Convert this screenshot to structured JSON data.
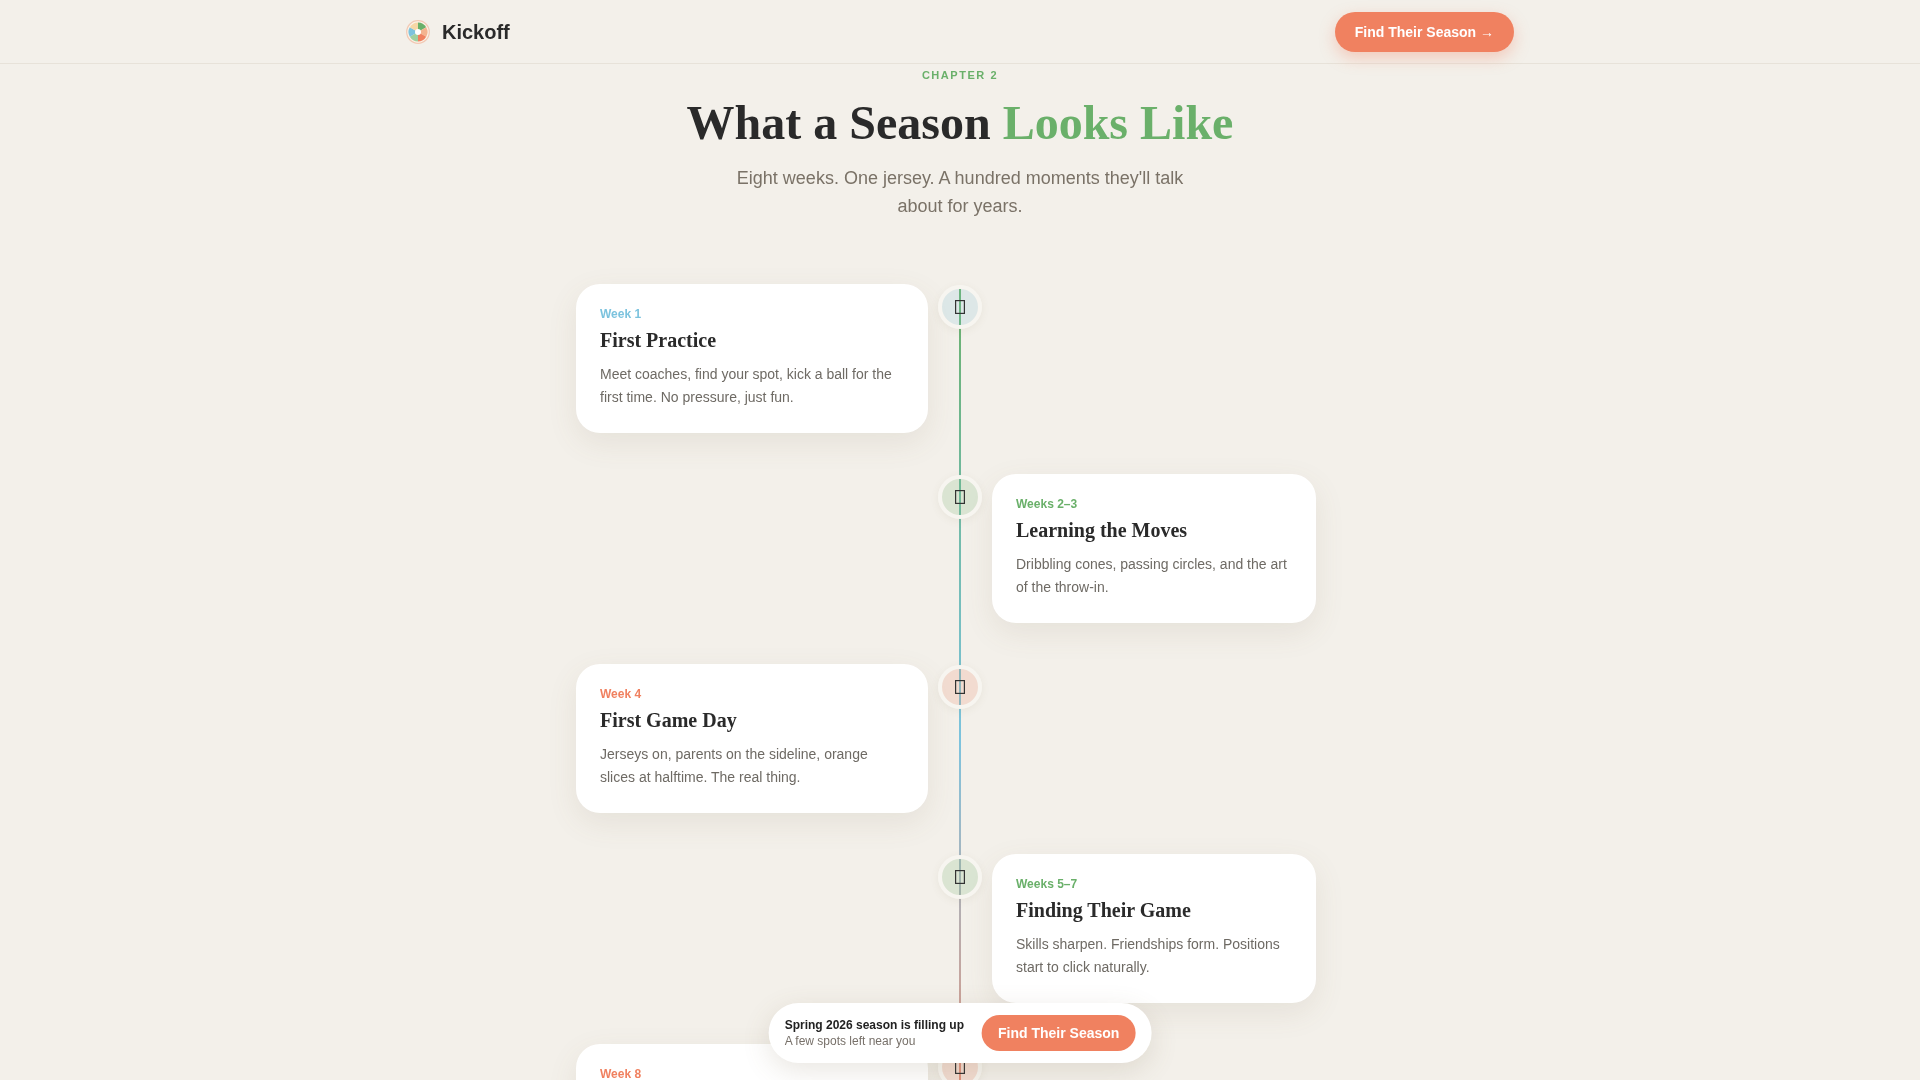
{
  "header": {
    "brand": "Kickoff",
    "cta": "Find Their Season →"
  },
  "intro": {
    "eyebrow": "CHAPTER 2",
    "title": "What a Season",
    "title_highlight": "Looks Like",
    "subtitle": "Eight weeks. One jersey. A hundred moments they'll talk about for years."
  },
  "timeline": [
    {
      "label": "Week 1",
      "color": "#7cc3de",
      "title": "First Practice",
      "text": "Meet coaches, find your spot, kick a ball for the first time. No pressure, just fun."
    },
    {
      "label": "Weeks 2–3",
      "color": "#6ab06a",
      "title": "Learning the Moves",
      "text": "Dribbling cones, passing circles, and the art of the throw-in."
    },
    {
      "label": "Week 4",
      "color": "#f08160",
      "title": "First Game Day",
      "text": "Jerseys on, parents on the sideline, orange slices at halftime. The real thing."
    },
    {
      "label": "Weeks 5–7",
      "color": "#6ab06a",
      "title": "Finding Their Game",
      "text": "Skills sharpen. Friendships form. Positions start to click naturally."
    },
    {
      "label": "Week 8",
      "color": "#f08160"
    }
  ],
  "banner": {
    "title": "Spring 2026 season is filling up",
    "subtitle": "A few spots left near you",
    "button": "Find Their Season"
  }
}
